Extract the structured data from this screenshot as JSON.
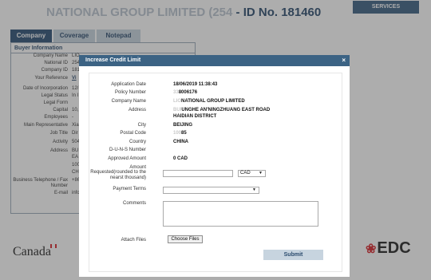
{
  "header": {
    "title_masked": "NATIONAL GROUP LIMITED (254",
    "title_id": "- ID No. 181460",
    "services_button": "SERVICES"
  },
  "tabs": [
    {
      "label": "Company",
      "active": true
    },
    {
      "label": "Coverage",
      "active": false
    },
    {
      "label": "Notepad",
      "active": false
    }
  ],
  "buyer_info": {
    "heading": "Buyer Information",
    "rows": [
      {
        "label": "Company Name",
        "value": "LIO"
      },
      {
        "label": "National ID",
        "value": "254"
      },
      {
        "label": "Company ID",
        "value": "181"
      },
      {
        "label": "Your Reference",
        "value": "Vi"
      },
      {
        "label": "Date of Incorporation",
        "value": "12/"
      },
      {
        "label": "Legal Status",
        "value": "In I"
      },
      {
        "label": "Legal Form",
        "value": ""
      },
      {
        "label": "Capital",
        "value": "10,"
      },
      {
        "label": "Employees",
        "value": "-"
      },
      {
        "label": "Main Representative",
        "value": "Xia"
      },
      {
        "label": "Job Title",
        "value": "Dir"
      },
      {
        "label": "Activity",
        "value": "504"
      },
      {
        "label": "Address",
        "value": "BU"
      },
      {
        "label": "",
        "value": "EA"
      },
      {
        "label": "",
        "value": "100"
      },
      {
        "label": "",
        "value": "CH"
      },
      {
        "label": "Business Telephone / Fax",
        "value": "+86"
      },
      {
        "label": "Number",
        "value": ""
      },
      {
        "label": "E-mail",
        "value": "info"
      }
    ]
  },
  "footer": {
    "canada_wordmark": "Canada",
    "edc_wordmark": "EDC"
  },
  "modal": {
    "title": "Increase Credit Limit",
    "close_glyph": "×",
    "fields": {
      "application_date": {
        "label": "Application Date",
        "value": "18/06/2019 11:38:43"
      },
      "policy_number": {
        "label": "Policy Number",
        "value_masked": "33",
        "value": "8006176"
      },
      "company_name": {
        "label": "Company Name",
        "value_masked": "LIO",
        "value": "NATIONAL GROUP LIMITED"
      },
      "address": {
        "label": "Address",
        "value_masked": "BUI",
        "value_line1": "UNGHE AN'NINGZHUANG EAST ROAD",
        "value_line2": "HAIDIAN DISTRICT"
      },
      "city": {
        "label": "City",
        "value": "BEIJING"
      },
      "postal_code": {
        "label": "Postal Code",
        "value_masked": "100",
        "value": "85"
      },
      "country": {
        "label": "Country",
        "value": "CHINA"
      },
      "duns": {
        "label": "D-U-N-S Number",
        "value": ""
      },
      "approved_amount": {
        "label": "Approved Amount",
        "value": "0 CAD"
      },
      "amount_requested": {
        "label_line1": "Amount",
        "label_line2": "Requested(rounded to the",
        "label_line3": "nearst thousand)",
        "value": "",
        "currency": "CAD"
      },
      "payment_terms": {
        "label": "Payment Terms",
        "value": ""
      },
      "comments": {
        "label": "Comments",
        "value": ""
      },
      "attach_files": {
        "label": "Attach Files",
        "button": "Choose Files"
      }
    },
    "submit_button": "Submit"
  }
}
